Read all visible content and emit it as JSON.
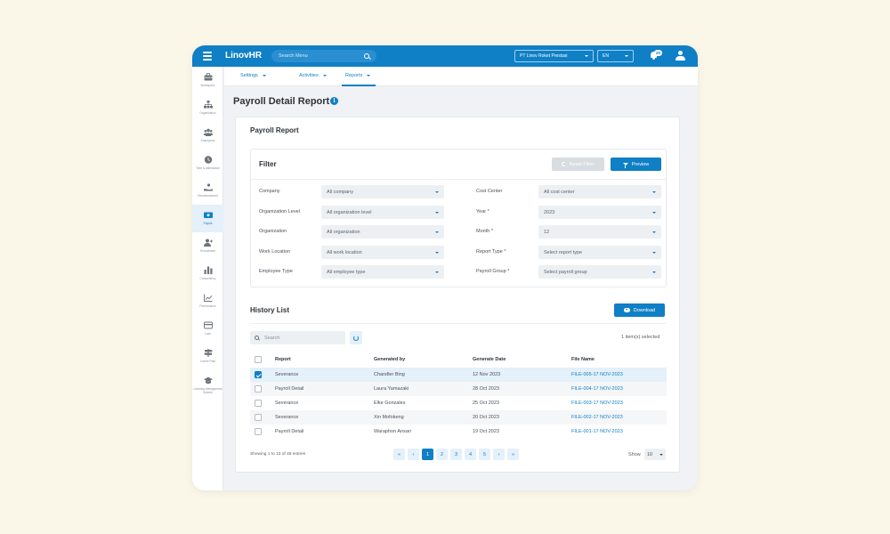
{
  "topbar": {
    "brand": "LinovHR",
    "search_placeholder": "Search Menu",
    "company": "PT Linov Roket Prestasi",
    "language": "EN",
    "notification_count": "20"
  },
  "sidebar": {
    "items": [
      {
        "label": "Workspace",
        "icon": "briefcase-icon"
      },
      {
        "label": "Organization",
        "icon": "org-chart-icon"
      },
      {
        "label": "Employees",
        "icon": "people-icon"
      },
      {
        "label": "Time & Attendance",
        "icon": "clock-icon"
      },
      {
        "label": "Reimbursement",
        "icon": "hand-coin-icon"
      },
      {
        "label": "Payroll",
        "icon": "payroll-icon"
      },
      {
        "label": "Recruitment",
        "icon": "user-add-icon"
      },
      {
        "label": "Competency",
        "icon": "bar-chart-icon"
      },
      {
        "label": "Performance",
        "icon": "trend-icon"
      },
      {
        "label": "Loan",
        "icon": "card-icon"
      },
      {
        "label": "Career Path",
        "icon": "signpost-icon"
      },
      {
        "label": "Learning Management System",
        "icon": "graduation-cap-icon"
      }
    ],
    "active_index": 5
  },
  "subnav": {
    "items": [
      "Settings",
      "Activities",
      "Reports"
    ],
    "active": "Reports"
  },
  "page": {
    "title": "Payroll Detail Report"
  },
  "card": {
    "title": "Payroll Report",
    "filter": {
      "title": "Filter",
      "reset_label": "Reset Filter",
      "preview_label": "Preview",
      "left_fields": [
        {
          "label": "Company",
          "value": "All company"
        },
        {
          "label": "Organization Level",
          "value": "All organization level"
        },
        {
          "label": "Organization",
          "value": "All organization"
        },
        {
          "label": "Work Location",
          "value": "All work location"
        },
        {
          "label": "Employee Type",
          "value": "All employee type"
        }
      ],
      "right_fields": [
        {
          "label": "Cost Center",
          "value": "All cost center"
        },
        {
          "label": "Year *",
          "value": "2023"
        },
        {
          "label": "Month *",
          "value": "12"
        },
        {
          "label": "Report Type *",
          "value": "Select report type"
        },
        {
          "label": "Payroll Group *",
          "value": "Select payroll group"
        }
      ]
    },
    "history": {
      "title": "History List",
      "download_label": "Download",
      "search_placeholder": "Search",
      "selected_text": "1 item(s) selected",
      "columns": [
        "Report",
        "Generated by",
        "Generate Date",
        "File Name"
      ],
      "rows": [
        {
          "report": "Severance",
          "by": "Chandler Bing",
          "date": "12 Nov 2023",
          "file": "FILE-005-17 NOV-2023",
          "checked": true
        },
        {
          "report": "Payroll Detail",
          "by": "Laura Yamazaki",
          "date": "28 Oct 2023",
          "file": "FILE-004-17 NOV-2023",
          "checked": false
        },
        {
          "report": "Severance",
          "by": "Elke Gonzales",
          "date": "25 Oct 2023",
          "file": "FILE-003-17 NOV-2023",
          "checked": false
        },
        {
          "report": "Severance",
          "by": "Xin Mofokeng",
          "date": "20 Oct 2023",
          "file": "FILE-002-17 NOV-2023",
          "checked": false
        },
        {
          "report": "Payroll Detail",
          "by": "Waraphon Ansari",
          "date": "19 Oct 2023",
          "file": "FILE-001-17 NOV-2023",
          "checked": false
        }
      ],
      "showing_text": "Showing 1 to 10 of 48 entries",
      "pager": {
        "first": "«",
        "prev": "‹",
        "pages": [
          "1",
          "2",
          "3",
          "4",
          "5"
        ],
        "next": "›",
        "last": "»",
        "active": "1"
      },
      "show_label": "Show",
      "page_size": "10"
    }
  },
  "colors": {
    "primary": "#0f7fc6",
    "background": "#faf6e8"
  }
}
